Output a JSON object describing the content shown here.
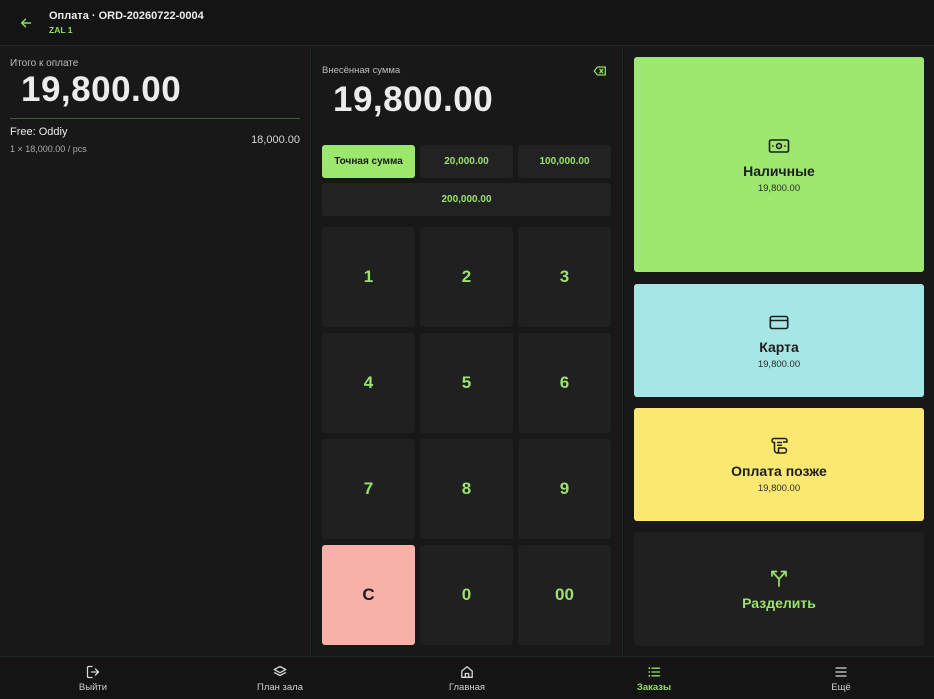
{
  "header": {
    "title": "Оплата · ORD-20260722-0004",
    "subtitle": "ZAL 1"
  },
  "summary": {
    "total_label": "Итого к оплате",
    "total_value": "19,800.00",
    "items": [
      {
        "name": "Free: Oddiy",
        "qty_line": "1 × 18,000.00 / pcs",
        "sum": "18,000.00"
      }
    ]
  },
  "entry": {
    "label": "Внесённая сумма",
    "value": "19,800.00"
  },
  "quick_amounts": [
    {
      "label": "Точная сумма",
      "selected": true
    },
    {
      "label": "20,000.00",
      "selected": false
    },
    {
      "label": "100,000.00",
      "selected": false
    },
    {
      "label": "200,000.00",
      "selected": false
    }
  ],
  "keypad": [
    "1",
    "2",
    "3",
    "4",
    "5",
    "6",
    "7",
    "8",
    "9",
    "C",
    "0",
    "00"
  ],
  "payment_methods": {
    "cash": {
      "label": "Наличные",
      "amount": "19,800.00",
      "color": "#9de86f",
      "icon": "cash-icon"
    },
    "card": {
      "label": "Карта",
      "amount": "19,800.00",
      "color": "#a6e6e6",
      "icon": "credit-card-icon"
    },
    "later": {
      "label": "Оплата позже",
      "amount": "19,800.00",
      "color": "#fbe870",
      "icon": "receipt-scroll-icon"
    },
    "split": {
      "label": "Разделить",
      "icon": "split-arrows-icon"
    }
  },
  "bottom_nav": [
    {
      "label": "Выйти",
      "icon": "logout-icon",
      "active": false
    },
    {
      "label": "План зала",
      "icon": "layers-icon",
      "active": false
    },
    {
      "label": "Главная",
      "icon": "home-icon",
      "active": false
    },
    {
      "label": "Заказы",
      "icon": "list-icon",
      "active": true
    },
    {
      "label": "Ещё",
      "icon": "menu-icon",
      "active": false
    }
  ],
  "colors": {
    "accent": "#8fe067",
    "background": "#121212",
    "clear_key": "#f7b1a8"
  }
}
